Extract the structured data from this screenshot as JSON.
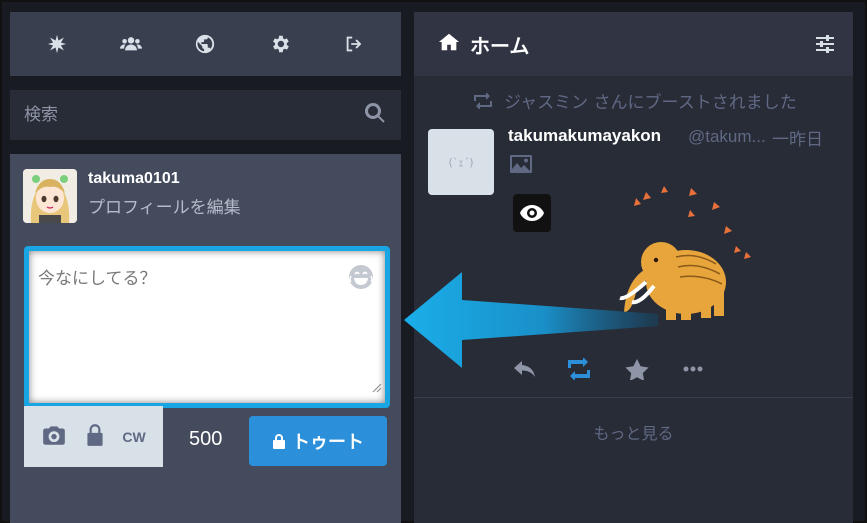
{
  "nav": {
    "icons": [
      "asterisk-icon",
      "users-icon",
      "globe-icon",
      "gear-icon",
      "sign-out-icon"
    ]
  },
  "search": {
    "placeholder": "検索"
  },
  "profile": {
    "username": "takuma0101",
    "edit_label": "プロフィールを編集"
  },
  "compose": {
    "placeholder": "今なにしてる？",
    "cw_label": "CW",
    "char_count": "500",
    "toot_label": "トゥート"
  },
  "column": {
    "title": "ホーム"
  },
  "status": {
    "boost_text": "ジャスミン さんにブーストされました",
    "display_name": "takumakumayakon",
    "acct": "@takum...",
    "time": "一昨日",
    "avatar_placeholder": "(`ｪ´)"
  },
  "load_more": "もっと見る",
  "colors": {
    "accent": "#2b90d9",
    "highlight": "#17a5e3",
    "boost_active": "#2b90d9"
  }
}
